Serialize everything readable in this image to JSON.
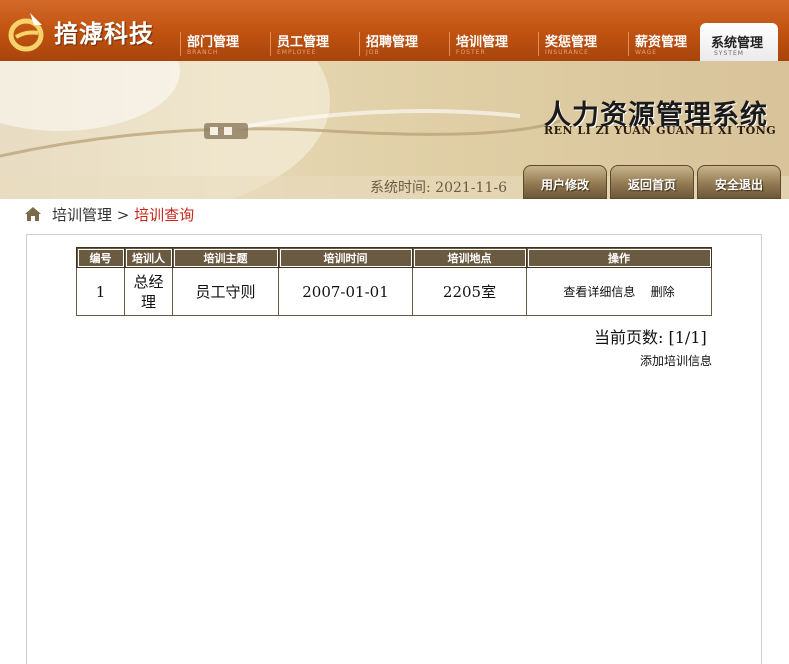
{
  "header": {
    "brand": "揞滹科技",
    "nav": [
      {
        "label": "部门管理",
        "sub": "BRANCH"
      },
      {
        "label": "员工管理",
        "sub": "EMPLOYEE"
      },
      {
        "label": "招聘管理",
        "sub": "JOB"
      },
      {
        "label": "培训管理",
        "sub": "FOSTER"
      },
      {
        "label": "奖惩管理",
        "sub": "INSURANCE"
      },
      {
        "label": "薪资管理",
        "sub": "WAGE"
      },
      {
        "label": "系统管理",
        "sub": "SYSTEM",
        "active": true
      }
    ]
  },
  "banner": {
    "title": "人力资源管理系统",
    "subtitle": "REN LI ZI YUAN GUAN LI XI TONG",
    "time_label": "系统时间:",
    "time_value": "2021-11-6",
    "buttons": [
      "用户修改",
      "返回首页",
      "安全退出"
    ]
  },
  "breadcrumb": {
    "parent": "培训管理",
    "separator": ">",
    "current": "培训查询"
  },
  "table": {
    "headers": [
      "编号",
      "培训人",
      "培训主题",
      "培训时间",
      "培训地点",
      "操作"
    ],
    "rows": [
      {
        "id": "1",
        "person": "总经理",
        "topic": "员工守则",
        "time": "2007-01-01",
        "place": "2205室",
        "view": "查看详细信息",
        "delete": "删除"
      }
    ]
  },
  "pager": {
    "label": "当前页数:",
    "value": "[1/1]"
  },
  "actions": {
    "add": "添加培训信息"
  },
  "colors": {
    "header_bar": "#c45512",
    "table_header": "#6b5a42",
    "crumb_current": "#c8261a"
  }
}
